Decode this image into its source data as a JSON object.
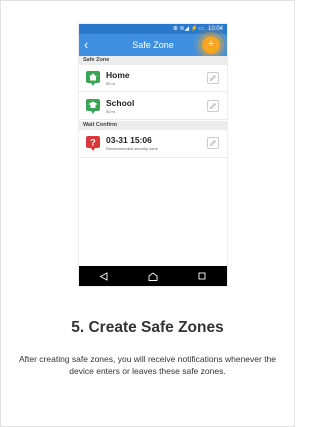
{
  "status_bar": {
    "signal": "⊕ ≋◢ ⚡▭",
    "time": "10:04"
  },
  "app_bar": {
    "title": "Safe Zone",
    "back_icon": "chevron-left-icon",
    "add_icon": "plus-icon"
  },
  "sections": {
    "safe_zone": {
      "label": "Safe Zone",
      "items": [
        {
          "name": "Home",
          "sub": "50 m",
          "icon": "home-pin-icon"
        },
        {
          "name": "School",
          "sub": "50 m",
          "icon": "school-pin-icon"
        }
      ]
    },
    "wait_confirm": {
      "label": "Wait Confirm",
      "items": [
        {
          "name": "03-31 15:06",
          "sub": "Recommended security zone",
          "icon": "question-pin-icon"
        }
      ]
    }
  },
  "nav": {
    "back": "back-triangle-icon",
    "home": "home-outline-icon",
    "recent": "recent-square-icon"
  },
  "caption": {
    "headline": "5. Create Safe Zones",
    "description": "After creating safe zones, you will receive notifications whenever the device enters or leaves these safe zones."
  },
  "colors": {
    "status_bar": "#2a78cc",
    "app_bar": "#3f8fe0",
    "accent": "#f5a623",
    "pin_green": "#3aa655",
    "pin_red": "#d9393a"
  }
}
